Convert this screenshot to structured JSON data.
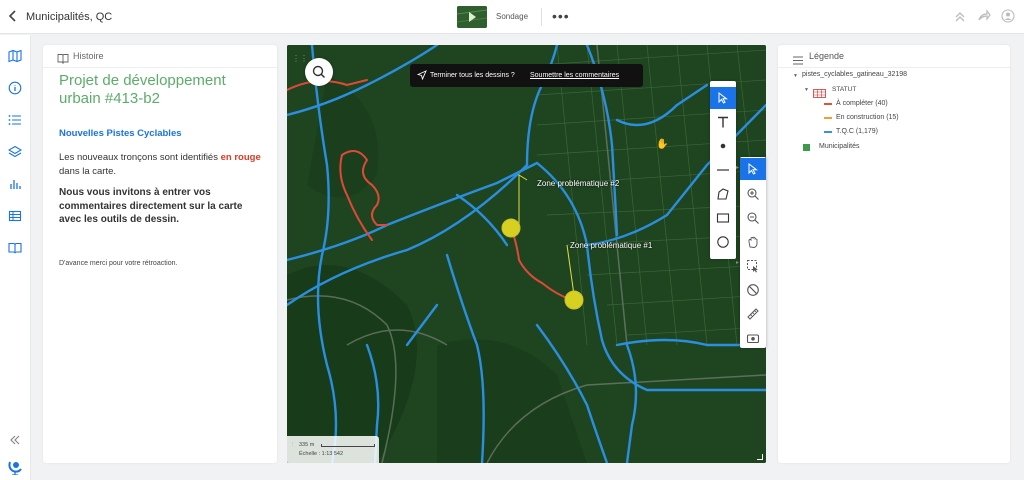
{
  "topbar": {
    "title": "Municipalités, QC",
    "tab_label": "Sondage",
    "more_label": "•••"
  },
  "story": {
    "header": "Histoire",
    "title": "Projet de développement urbain #413-b2",
    "subtitle": "Nouvelles Pistes Cyclables",
    "p1_before": "Les nouveaux tronçons sont identifiés",
    "p1_highlight": "en rouge",
    "p1_after": "dans la carte.",
    "p2": "Nous vous invitons à entrer vos commentaires directement sur la carte avec les outils de dessin.",
    "p3": "D'avance merci pour votre rétroaction."
  },
  "map": {
    "banner_question": "Terminer tous les dessins ?",
    "banner_link": "Soumettre les commentaires",
    "zone2_label": "Zone problématique #2",
    "zone1_label": "Zone problématique #1",
    "scale_value": "335 m",
    "scale_label": "Échelle : 1:13 542"
  },
  "legend": {
    "header": "Légende",
    "layer_name": "pistes_cyclables_gatineau_32198",
    "statut_label": "STATUT",
    "items": [
      {
        "label": "À compléter (40)",
        "color": "#e0533a"
      },
      {
        "label": "En construction (15)",
        "color": "#f0a030"
      },
      {
        "label": "T.Q.C (1,179)",
        "color": "#3a8ee6"
      }
    ],
    "municipalities_label": "Municipalités",
    "municipalities_color": "#3c9a4e"
  },
  "colors": {
    "accent": "#1a73e8",
    "title_green": "#5cac6a",
    "highlight_red": "#e03a24",
    "map_bg": "#1f4520",
    "bike_blue": "#2a8fe0",
    "bike_red": "#e0483a",
    "zone_yellow": "#d8d020"
  }
}
